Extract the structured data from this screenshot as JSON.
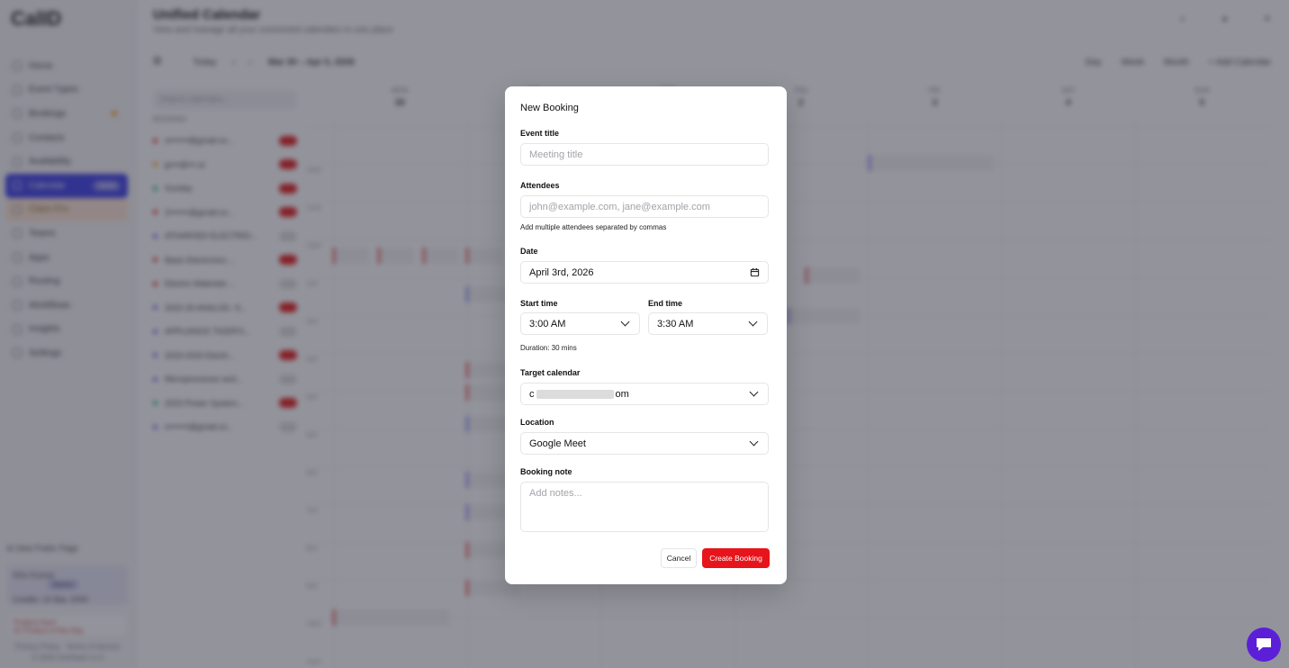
{
  "app": {
    "logo": "CalID",
    "nav": [
      {
        "label": "Home"
      },
      {
        "label": "Event Types"
      },
      {
        "label": "Bookings"
      },
      {
        "label": "Contacts"
      },
      {
        "label": "Availability"
      },
      {
        "label": "Calendar",
        "active": true,
        "badge": "NEW"
      },
      {
        "label": "Claim Pro",
        "warn": true
      },
      {
        "label": "Teams"
      },
      {
        "label": "Apps"
      },
      {
        "label": "Routing"
      },
      {
        "label": "Workflows"
      },
      {
        "label": "Insights"
      },
      {
        "label": "Settings"
      }
    ],
    "view_public": "View Public Page",
    "user_name": "Shiv Kumar",
    "user_plan": "Starter",
    "user_credits": "Credits: 10 Bal, 2000",
    "promo_line1": "Product Hunt",
    "promo_line2": "#1 Product of the Day",
    "footer_links": "Privacy Policy · Terms of Service",
    "footer_copy": "© 2025 OneHash v1.0"
  },
  "main": {
    "title": "Unified Calendar",
    "subtitle": "View and manage all your connected calendars in one place",
    "today": "Today",
    "range": "Mar 30 – Apr 5, 2026",
    "views": [
      "Day",
      "Week",
      "Month",
      "+ Add Calendar"
    ],
    "search_placeholder": "Search calendars...",
    "calendars_heading": "BOOKING",
    "calendars": [
      {
        "name": "s•••••••@gmail.co...",
        "color": "#e21c1c",
        "on": true
      },
      {
        "name": "jp•••@•••.ai",
        "color": "#f59e0b",
        "on": true
      },
      {
        "name": "Sunday",
        "color": "#10b981",
        "on": true
      },
      {
        "name": "2•••••••@gmail.co...",
        "color": "#e21c1c",
        "on": true
      },
      {
        "name": "ATHARVED ELECTRIO...",
        "color": "#6366f1",
        "on": false
      },
      {
        "name": "Basic Electronics ...",
        "color": "#e21c1c",
        "on": true
      },
      {
        "name": "Electric Materials ...",
        "color": "#e21c1c",
        "on": false
      },
      {
        "name": "2022-26 ANALOG -S...",
        "color": "#6366f1",
        "on": true
      },
      {
        "name": "APPLIANCE TIGER'S...",
        "color": "#6366f1",
        "on": false
      },
      {
        "name": "2023-2024 Electri...",
        "color": "#6366f1",
        "on": true
      },
      {
        "name": "Microprocessor and...",
        "color": "#6366f1",
        "on": false
      },
      {
        "name": "2023 Power System...",
        "color": "#10b981",
        "on": true
      },
      {
        "name": "s•••••••@gmail.co...",
        "color": "#6366f1",
        "on": false
      }
    ],
    "days": [
      {
        "name": "MON",
        "num": "30"
      },
      {
        "name": "TUE",
        "num": "31"
      },
      {
        "name": "WED",
        "num": "1"
      },
      {
        "name": "THU",
        "num": "2"
      },
      {
        "name": "FRI",
        "num": "3"
      },
      {
        "name": "SAT",
        "num": "4"
      },
      {
        "name": "SUN",
        "num": "5"
      }
    ],
    "hours": [
      "10am",
      "11am",
      "12pm",
      "1pm",
      "2pm",
      "3pm",
      "4pm",
      "5pm",
      "6pm",
      "7pm",
      "8pm",
      "9pm",
      "10pm",
      "11pm"
    ]
  },
  "modal": {
    "title": "New Booking",
    "event_title_label": "Event title",
    "event_title_placeholder": "Meeting title",
    "attendees_label": "Attendees",
    "attendees_placeholder": "john@example.com, jane@example.com",
    "attendees_helper": "Add multiple attendees separated by commas",
    "date_label": "Date",
    "date_value": "April 3rd, 2026",
    "start_label": "Start time",
    "start_value": "3:00 AM",
    "end_label": "End time",
    "end_value": "3:30 AM",
    "duration": "Duration: 30 mins",
    "target_label": "Target calendar",
    "target_prefix": "c",
    "target_suffix": "om",
    "location_label": "Location",
    "location_value": "Google Meet",
    "note_label": "Booking note",
    "note_placeholder": "Add notes...",
    "cancel_label": "Cancel",
    "create_label": "Create Booking"
  },
  "colors": {
    "accent": "#e8141b",
    "nav_active": "#3b3ee8",
    "chat": "#5b1fd8"
  }
}
